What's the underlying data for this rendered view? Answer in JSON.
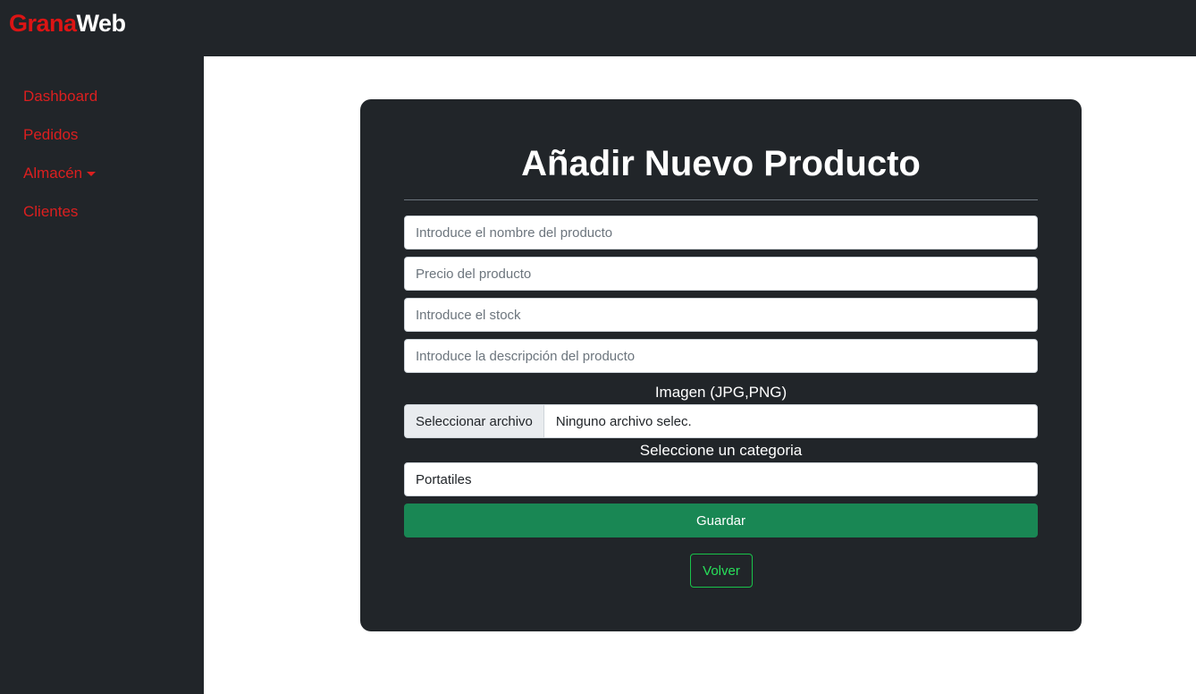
{
  "brand": {
    "part1": "Grana",
    "part2": "Web"
  },
  "sidebar": {
    "items": [
      {
        "label": "Dashboard"
      },
      {
        "label": "Pedidos"
      },
      {
        "label": "Almacén",
        "has_dropdown": true
      },
      {
        "label": "Clientes"
      }
    ]
  },
  "form": {
    "title": "Añadir Nuevo Producto",
    "name_placeholder": "Introduce el nombre del producto",
    "price_placeholder": "Precio del producto",
    "stock_placeholder": "Introduce el stock",
    "description_placeholder": "Introduce la descripción del producto",
    "image_label": "Imagen (JPG,PNG)",
    "file_button": "Seleccionar archivo",
    "file_status": "Ninguno archivo selec.",
    "category_label": "Seleccione un categoria",
    "category_selected": "Portatiles",
    "save_label": "Guardar",
    "back_label": "Volver"
  },
  "colors": {
    "dark": "#212529",
    "brand_red": "#dc1414",
    "save_green": "#198754",
    "back_green": "#28e05a"
  }
}
